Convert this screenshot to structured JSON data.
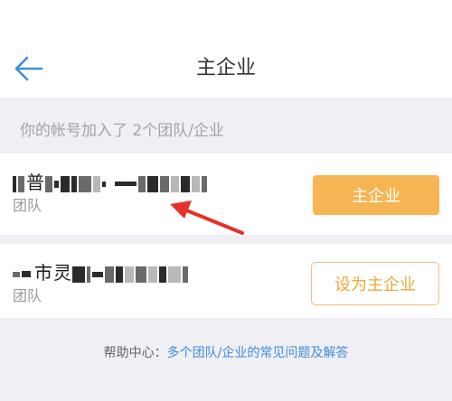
{
  "header": {
    "title": "主企业",
    "back_icon": "arrow-left-icon",
    "back_color": "#3e8ed8"
  },
  "section": {
    "label": "你的帐号加入了 2个团队/企业"
  },
  "orgs": [
    {
      "name_visible": "普",
      "type": "团队",
      "button_label": "主企业",
      "button_color": "#f6b553"
    },
    {
      "name_visible": "市灵",
      "type": "团队",
      "button_label": "设为主企业",
      "button_color": "#f0a93a"
    }
  ],
  "help": {
    "prefix": "帮助中心：",
    "link": "多个团队/企业的常见问题及解答"
  },
  "annotation": {
    "color": "#e8302a"
  }
}
